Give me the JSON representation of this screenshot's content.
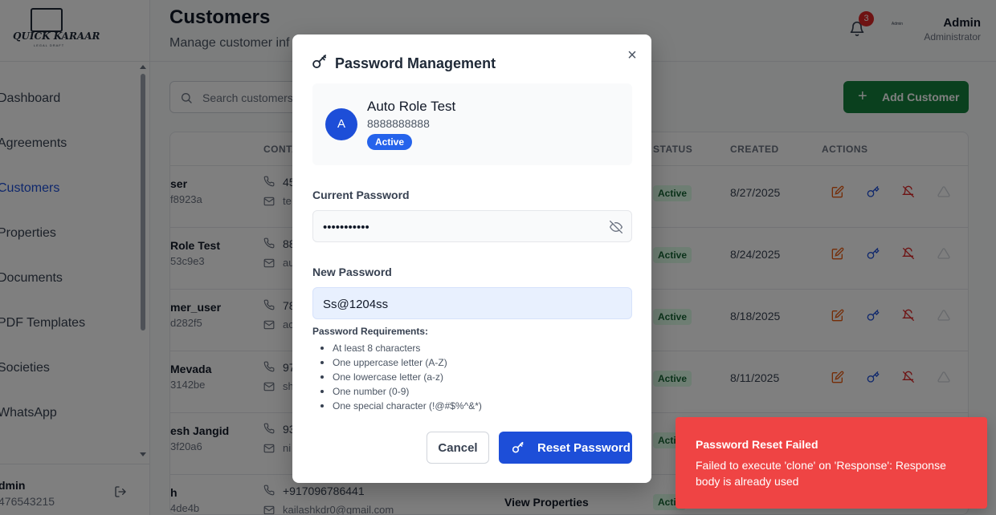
{
  "app": {
    "brand": "QUICK KARAAR",
    "brand_tagline": "LEGAL DRAFT"
  },
  "sidebar": {
    "items": [
      {
        "label": "Dashboard"
      },
      {
        "label": "Agreements"
      },
      {
        "label": "Customers",
        "active": true
      },
      {
        "label": "Properties"
      },
      {
        "label": "Documents"
      },
      {
        "label": "PDF Templates"
      },
      {
        "label": "Societies"
      },
      {
        "label": "WhatsApp"
      }
    ],
    "user": {
      "name": "dmin",
      "phone": "476543215"
    }
  },
  "header": {
    "title": "Customers",
    "subtitle": "Manage customer inf",
    "notification_count": "3",
    "avatar_text": "Admin",
    "user_name": "Admin",
    "user_role": "Administrator"
  },
  "toolbar": {
    "search_placeholder": "Search customers",
    "add_label": "Add Customer"
  },
  "table": {
    "headers": {
      "contact": "CONTA",
      "status": "STATUS",
      "created": "CREATED",
      "actions": "ACTIONS"
    },
    "rows": [
      {
        "name": "ser",
        "id": "f8923a",
        "phone": "45",
        "email": "te",
        "status": "Active",
        "created": "8/27/2025"
      },
      {
        "name": "Role Test",
        "id": "53c9e3",
        "phone": "88",
        "email": "au",
        "status": "Active",
        "created": "8/24/2025"
      },
      {
        "name": "mer_user",
        "id": "d282f5",
        "phone": "78",
        "email": "ac",
        "status": "Active",
        "created": "8/18/2025"
      },
      {
        "name": "Mevada",
        "id": "3142be",
        "phone": "97",
        "email": "sh",
        "status": "Active",
        "created": "8/11/2025"
      },
      {
        "name": "esh Jangid",
        "id": "3f20a6",
        "phone": "93",
        "email": "ni",
        "status": "Active",
        "created": ""
      },
      {
        "name": "h",
        "id": "4de4b",
        "phone": "+917096786441",
        "email": "kailashkdr0@gmail.com",
        "status": "Activ",
        "created": "",
        "view_label": "View Properties"
      }
    ]
  },
  "modal": {
    "title": "Password Management",
    "user": {
      "initial": "A",
      "name": "Auto Role Test",
      "phone": "8888888888",
      "status": "Active"
    },
    "current_password_label": "Current Password",
    "current_password_value": "•••••••••••",
    "new_password_label": "New Password",
    "new_password_value": "Ss@1204ss",
    "requirements_title": "Password Requirements:",
    "requirements": [
      "At least 8 characters",
      "One uppercase letter (A-Z)",
      "One lowercase letter (a-z)",
      "One number (0-9)",
      "One special character (!@#$%^&*)"
    ],
    "cancel_label": "Cancel",
    "reset_label": "Reset Password"
  },
  "toast": {
    "title": "Password Reset Failed",
    "message": "Failed to execute 'clone' on 'Response': Response body is already used"
  },
  "colors": {
    "primary": "#1d4ed8",
    "success": "#15803d",
    "danger": "#ef4444",
    "edit_icon": "#ea580c",
    "key_icon": "#1d4ed8",
    "deactivate_icon": "#dc2626"
  }
}
